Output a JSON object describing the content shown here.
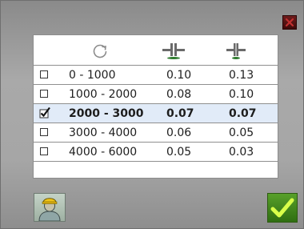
{
  "dialog": {
    "close_icon": "close-x-icon",
    "header_icons": [
      "refresh-icon",
      "wide-clamp-icon",
      "narrow-clamp-icon"
    ]
  },
  "table": {
    "rows": [
      {
        "range": "0 - 1000",
        "v1": "0.10",
        "v2": "0.13",
        "checked": false
      },
      {
        "range": "1000 - 2000",
        "v1": "0.08",
        "v2": "0.10",
        "checked": false
      },
      {
        "range": "2000 - 3000",
        "v1": "0.07",
        "v2": "0.07",
        "checked": true
      },
      {
        "range": "3000 - 4000",
        "v1": "0.06",
        "v2": "0.05",
        "checked": false
      },
      {
        "range": "4000 - 6000",
        "v1": "0.05",
        "v2": "0.03",
        "checked": false
      }
    ]
  },
  "footer": {
    "user_icon": "worker-helmet-icon",
    "confirm_icon": "checkmark-icon"
  },
  "colors": {
    "selected_row": "#e1ebf8",
    "confirm_green": "#4a9a21",
    "close_red": "#5a1414"
  }
}
